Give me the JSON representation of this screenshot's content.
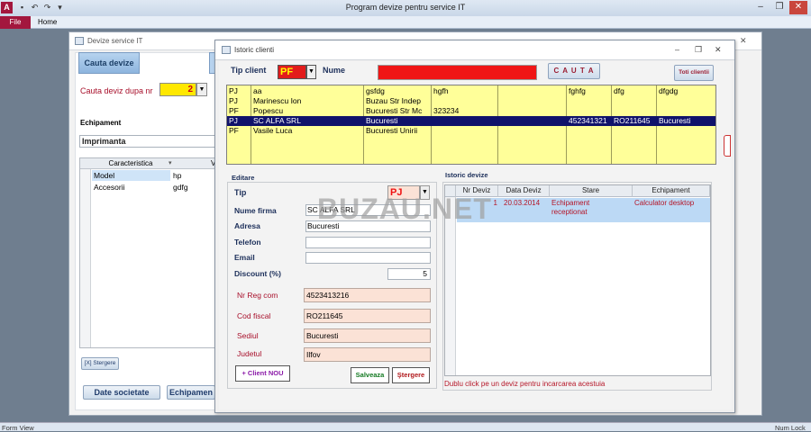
{
  "app": {
    "title": "Program devize pentru service IT",
    "tab_file": "File",
    "tab_home": "Home"
  },
  "status": {
    "left": "Form View",
    "right": "Num Lock"
  },
  "mainform": {
    "title": "Devize service IT",
    "tab_label": "Cauta devize",
    "search_label": "Cauta deviz dupa nr",
    "search_value": "2",
    "equip_label": "Echipament",
    "equip_value": "Imprimanta",
    "grid_header": "Caracteristica",
    "grid_header2": "V",
    "rows": [
      {
        "k": "Model",
        "v": "hp"
      },
      {
        "k": "Accesorii",
        "v": "gdfg"
      }
    ],
    "delete_btn": "[X] Stergere",
    "btn_company": "Date societate",
    "btn_equipment": "Echipamen"
  },
  "dialog": {
    "title": "Istoric clienti",
    "tip_client_label": "Tip client",
    "tip_client_value": "PF",
    "nume_label": "Nume",
    "cauta_btn": "C A U T A",
    "toti_btn": "Toti clientii",
    "clients": [
      [
        "PJ",
        "aa",
        "gsfdg",
        "hgfh",
        "",
        "fghfg",
        "dfg",
        "dfgdg"
      ],
      [
        "PJ",
        "Marinescu Ion",
        "Buzau Str Indep",
        "",
        "",
        "",
        "",
        ""
      ],
      [
        "PF",
        "Popescu",
        "Bucuresti Str Mc",
        "323234",
        "",
        "",
        "",
        ""
      ],
      [
        "PJ",
        "SC ALFA SRL",
        "Bucuresti",
        "",
        "",
        "452341321",
        "RO211645",
        "Bucuresti"
      ],
      [
        "PF",
        "Vasile Luca",
        "Bucuresti Unirii",
        "",
        "",
        "",
        "",
        ""
      ]
    ],
    "editare_label": "Editare",
    "tip_label": "Tip",
    "tip_value": "PJ",
    "nume_firma_label": "Nume firma",
    "nume_firma_value": "SC ALFA SRL",
    "adresa_label": "Adresa",
    "adresa_value": "Bucuresti",
    "telefon_label": "Telefon",
    "email_label": "Email",
    "discount_label": "Discount (%)",
    "discount_value": "5",
    "nrreg_label": "Nr Reg com",
    "nrreg_value": "4523413216",
    "codfiscal_label": "Cod fiscal",
    "codfiscal_value": "RO211645",
    "sediul_label": "Sediul",
    "sediul_value": "Bucuresti",
    "judetul_label": "Judetul",
    "judetul_value": "Ilfov",
    "client_nou_btn": "+ Client NOU",
    "salveaza_btn": "Salveaza",
    "stergere_btn": "Ştergere",
    "istoric_label": "Istoric devize",
    "istoric_headers": [
      "Nr Deviz",
      "Data Deviz",
      "Stare",
      "Echipament"
    ],
    "istoric_row": {
      "nr": "1",
      "data": "20.03.2014",
      "stare": "Echipament receptionat",
      "echip": "Calculator desktop"
    },
    "hint": "Dublu click pe un deviz pentru incarcarea acestuia"
  },
  "watermark": "BUZAU.NET"
}
